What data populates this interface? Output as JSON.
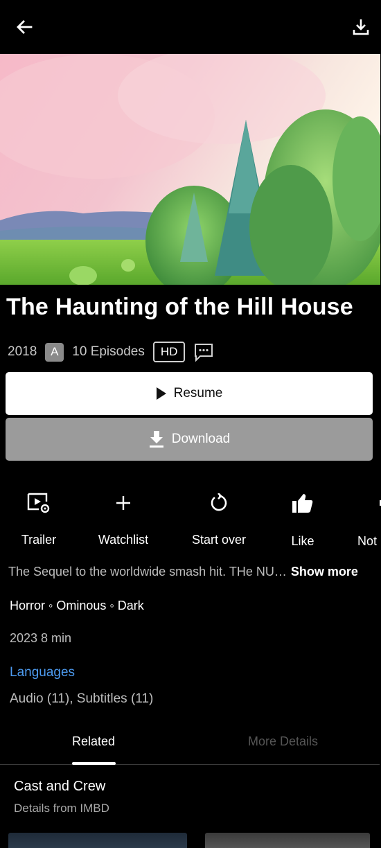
{
  "title": "The Haunting of the Hill House",
  "meta": {
    "year": "2018",
    "rating": "A",
    "episodes": "10 Episodes",
    "quality": "HD"
  },
  "buttons": {
    "resume": "Resume",
    "download": "Download"
  },
  "actions": [
    {
      "label": "Trailer",
      "icon": "trailer-icon"
    },
    {
      "label": "Watchlist",
      "icon": "plus-icon"
    },
    {
      "label": "Start over",
      "icon": "restart-icon"
    },
    {
      "label": "Like",
      "icon": "thumbs-up-icon"
    },
    {
      "label": "Not",
      "icon": "thumbs-down-icon"
    }
  ],
  "description": {
    "text": "The Sequel to the worldwide smash hit. THe NU…",
    "more": "Show more"
  },
  "genres": "Horror ◦ Ominous ◦ Dark",
  "year_duration": "2023  8 min",
  "languages": {
    "label": "Languages",
    "info": "Audio (11), Subtitles (11)"
  },
  "tabs": {
    "related": "Related",
    "more_details": "More Details"
  },
  "cast": {
    "title": "Cast and Crew",
    "subtitle": "Details from IMBD"
  },
  "colors": {
    "accent_link": "#4d9bf0",
    "download_button": "#9b9b9b"
  }
}
